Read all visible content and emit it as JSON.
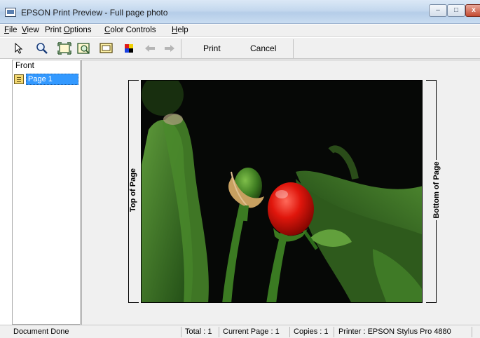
{
  "window": {
    "title": "EPSON Print Preview - Full page photo",
    "controls": {
      "minimize": "–",
      "maximize": "□",
      "close": "x"
    }
  },
  "menu": {
    "items": [
      {
        "key": "F",
        "rest": "ile"
      },
      {
        "key": "V",
        "rest": "iew"
      },
      {
        "pre": "Print ",
        "key": "O",
        "rest": "ptions"
      },
      {
        "key": "C",
        "rest": "olor Controls"
      },
      {
        "key": "H",
        "rest": "elp"
      }
    ]
  },
  "toolbar": {
    "icons": [
      "arrow-pointer-icon",
      "zoom-icon",
      "fit-page-icon",
      "zoom-page-icon",
      "margins-icon",
      "color-icon",
      "back-arrow-icon",
      "forward-arrow-icon"
    ],
    "print_label": "Print",
    "cancel_label": "Cancel"
  },
  "pages_panel": {
    "header": "Front",
    "pages": [
      {
        "label": "Page 1",
        "selected": true
      }
    ]
  },
  "preview": {
    "top_label": "Top of Page",
    "bottom_label": "Bottom of Page",
    "photo_subject": "red and green chili peppers on plant"
  },
  "status": {
    "message": "Document Done",
    "total": "Total : 1",
    "current_page": "Current Page : 1",
    "copies": "Copies : 1",
    "printer": "Printer : EPSON Stylus Pro 4880"
  },
  "colors": {
    "selection": "#3399ff",
    "background": "#f0f0f0",
    "title_bar": "#c4d8ee",
    "close_button": "#c44b32"
  }
}
